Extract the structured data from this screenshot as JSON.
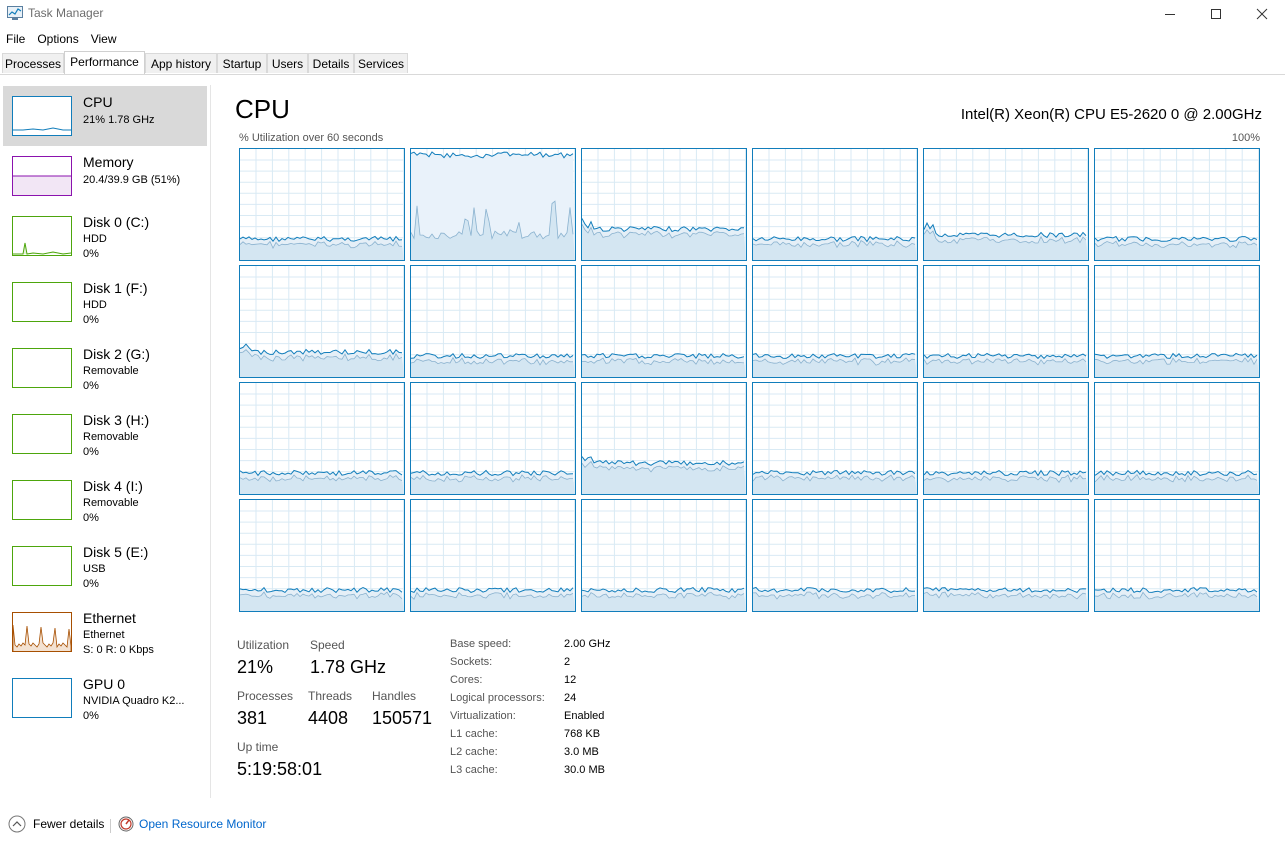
{
  "window": {
    "title": "Task Manager"
  },
  "menu": [
    "File",
    "Options",
    "View"
  ],
  "tabs": [
    "Processes",
    "Performance",
    "App history",
    "Startup",
    "Users",
    "Details",
    "Services"
  ],
  "sidebar": [
    {
      "title": "CPU",
      "sub1": "21%  1.78 GHz",
      "sub2": "",
      "color": "#117dbb"
    },
    {
      "title": "Memory",
      "sub1": "20.4/39.9 GB (51%)",
      "sub2": "",
      "color": "#8b12ae"
    },
    {
      "title": "Disk 0 (C:)",
      "sub1": "HDD",
      "sub2": "0%",
      "color": "#4da60c"
    },
    {
      "title": "Disk 1 (F:)",
      "sub1": "HDD",
      "sub2": "0%",
      "color": "#4da60c"
    },
    {
      "title": "Disk 2 (G:)",
      "sub1": "Removable",
      "sub2": "0%",
      "color": "#4da60c"
    },
    {
      "title": "Disk 3 (H:)",
      "sub1": "Removable",
      "sub2": "0%",
      "color": "#4da60c"
    },
    {
      "title": "Disk 4 (I:)",
      "sub1": "Removable",
      "sub2": "0%",
      "color": "#4da60c"
    },
    {
      "title": "Disk 5 (E:)",
      "sub1": "USB",
      "sub2": "0%",
      "color": "#4da60c"
    },
    {
      "title": "Ethernet",
      "sub1": "Ethernet",
      "sub2": "S: 0  R: 0 Kbps",
      "color": "#a74f01"
    },
    {
      "title": "GPU 0",
      "sub1": "NVIDIA Quadro K2...",
      "sub2": "0%",
      "color": "#117dbb"
    }
  ],
  "main": {
    "title": "CPU",
    "model": "Intel(R) Xeon(R) CPU E5-2620 0 @ 2.00GHz",
    "graph_label": "% Utilization over 60 seconds",
    "graph_max": "100%",
    "core_count": 24
  },
  "stats": {
    "utilization_label": "Utilization",
    "utilization": "21%",
    "speed_label": "Speed",
    "speed": "1.78 GHz",
    "processes_label": "Processes",
    "processes": "381",
    "threads_label": "Threads",
    "threads": "4408",
    "handles_label": "Handles",
    "handles": "150571",
    "uptime_label": "Up time",
    "uptime": "5:19:58:01"
  },
  "specs": [
    {
      "label": "Base speed:",
      "value": "2.00 GHz"
    },
    {
      "label": "Sockets:",
      "value": "2"
    },
    {
      "label": "Cores:",
      "value": "12"
    },
    {
      "label": "Logical processors:",
      "value": "24"
    },
    {
      "label": "Virtualization:",
      "value": "Enabled"
    },
    {
      "label": "L1 cache:",
      "value": "768 KB"
    },
    {
      "label": "L2 cache:",
      "value": "3.0 MB"
    },
    {
      "label": "L3 cache:",
      "value": "30.0 MB"
    }
  ],
  "footer": {
    "fewer_details": "Fewer details",
    "resource_monitor": "Open Resource Monitor"
  },
  "colors": {
    "cpu": "#117dbb",
    "memory": "#8b12ae",
    "disk": "#4da60c",
    "ethernet": "#a74f01",
    "accent_link": "#0066cc"
  }
}
